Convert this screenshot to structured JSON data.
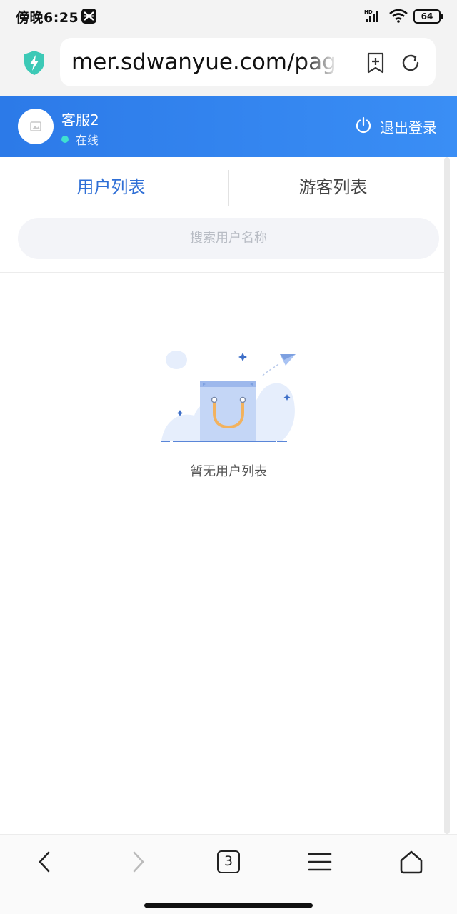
{
  "status_bar": {
    "time": "傍晚6:25",
    "battery": "64",
    "network": "HD"
  },
  "browser": {
    "url": "mer.sdwanyue.com/pag",
    "open_tabs": "3"
  },
  "header": {
    "agent_name": "客服2",
    "status": "在线",
    "logout_label": "退出登录"
  },
  "tabs": [
    {
      "label": "用户列表",
      "active": true
    },
    {
      "label": "游客列表",
      "active": false
    }
  ],
  "search": {
    "placeholder": "搜索用户名称"
  },
  "empty_state": {
    "message": "暂无用户列表"
  },
  "colors": {
    "accent": "#2f6fd6",
    "header_gradient_start": "#2c7ae8",
    "header_gradient_end": "#3a8ef5",
    "online_dot": "#3fe0d0",
    "shield": "#3cc9b6"
  },
  "icons": {
    "status_bar": [
      "capcut-icon",
      "signal-icon",
      "wifi-icon",
      "battery-icon"
    ],
    "browser": [
      "shield-icon",
      "bookmark-add-icon",
      "reload-icon"
    ],
    "header": [
      "avatar-placeholder-icon",
      "power-icon"
    ],
    "bottom_nav": [
      "back-icon",
      "forward-icon",
      "tabs-icon",
      "menu-icon",
      "home-icon"
    ]
  }
}
